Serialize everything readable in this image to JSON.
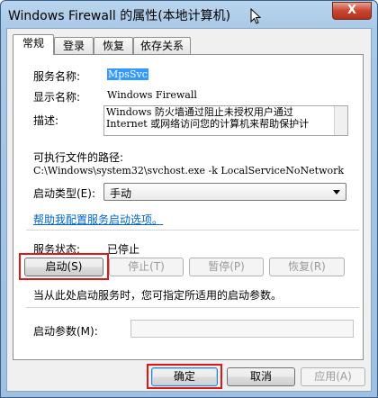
{
  "window": {
    "title": "Windows Firewall 的属性(本地计算机)",
    "close_glyph": "X"
  },
  "tabs": [
    {
      "label": "常规",
      "active": true
    },
    {
      "label": "登录",
      "active": false
    },
    {
      "label": "恢复",
      "active": false
    },
    {
      "label": "依存关系",
      "active": false
    }
  ],
  "general": {
    "service_name_label": "服务名称:",
    "service_name_value": "MpsSvc",
    "display_name_label": "显示名称:",
    "display_name_value": "Windows Firewall",
    "description_label": "描述:",
    "description_line1": "Windows 防火墙通过阻止未授权用户通过",
    "description_line2": "Internet 或网络访问您的计算机来帮助保护计",
    "path_label": "可执行文件的路径:",
    "path_value": "C:\\Windows\\system32\\svchost.exe -k LocalServiceNoNetwork",
    "startup_type_label": "启动类型(E):",
    "startup_type_value": "手动",
    "help_link": "帮助我配置服务启动选项。",
    "status_label": "服务状态:",
    "status_value": "已停止",
    "hint_text": "当从此处启动服务时，您可指定所适用的启动参数。",
    "params_label": "启动参数(M):",
    "params_value": ""
  },
  "service_buttons": {
    "start": "启动(S)",
    "stop": "停止(T)",
    "pause": "暂停(P)",
    "resume": "恢复(R)"
  },
  "dialog_buttons": {
    "ok": "确定",
    "cancel": "取消",
    "apply": "应用(A)"
  },
  "colors": {
    "highlight": "#e0161a",
    "link": "#0066cc",
    "selection": "#3399ff"
  }
}
